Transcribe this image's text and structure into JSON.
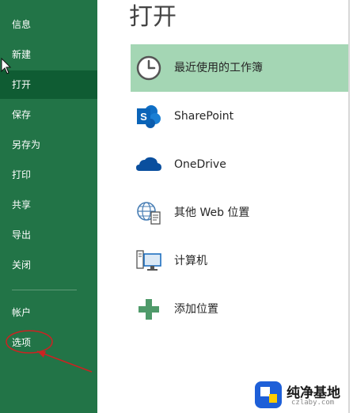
{
  "sidebar": {
    "items": [
      {
        "label": "信息"
      },
      {
        "label": "新建"
      },
      {
        "label": "打开",
        "active": true
      },
      {
        "label": "保存"
      },
      {
        "label": "另存为"
      },
      {
        "label": "打印"
      },
      {
        "label": "共享"
      },
      {
        "label": "导出"
      },
      {
        "label": "关闭"
      },
      {
        "label": "帐户"
      },
      {
        "label": "选项"
      }
    ],
    "background": "#227447",
    "active_background": "#0f5c33"
  },
  "main": {
    "title": "打开",
    "locations": [
      {
        "label": "最近使用的工作簿",
        "icon": "clock-icon",
        "selected": true
      },
      {
        "label": "SharePoint",
        "icon": "sharepoint-icon"
      },
      {
        "label": "OneDrive",
        "icon": "onedrive-cloud-icon"
      },
      {
        "label": "其他 Web 位置",
        "icon": "web-location-globe-icon"
      },
      {
        "label": "计算机",
        "icon": "computer-icon"
      },
      {
        "label": "添加位置",
        "icon": "add-place-plus-icon"
      }
    ],
    "selected_background": "#a4d6b4"
  },
  "annotation": {
    "color": "#cc2222",
    "marks": [
      "ellipse-around-options",
      "arrow-to-options"
    ]
  },
  "watermark": {
    "text": "纯净基地",
    "url": "czlaby.com"
  }
}
